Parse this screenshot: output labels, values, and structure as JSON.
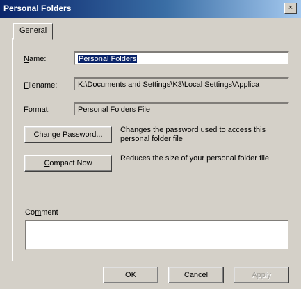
{
  "window": {
    "title": "Personal Folders",
    "close_glyph": "×"
  },
  "tabs": [
    {
      "label": "General"
    }
  ],
  "name_field": {
    "label_first": "N",
    "label_rest": "ame:",
    "value": "Personal Folders"
  },
  "filename_field": {
    "label_first": "F",
    "label_rest": "ilename:",
    "value": "K:\\Documents and Settings\\K3\\Local Settings\\Applica"
  },
  "format_field": {
    "label": "Format:",
    "value": "Personal Folders File"
  },
  "change_password": {
    "label_pre": "Change ",
    "label_u": "P",
    "label_post": "assword...",
    "description": "Changes the password used to access this personal folder file"
  },
  "compact_now": {
    "label_u": "C",
    "label_post": "ompact Now",
    "description": "Reduces the size of your personal folder file"
  },
  "comment": {
    "label_pre": "Co",
    "label_u": "m",
    "label_post": "ment",
    "value": ""
  },
  "footer": {
    "ok": "OK",
    "cancel": "Cancel",
    "apply": "Apply"
  }
}
